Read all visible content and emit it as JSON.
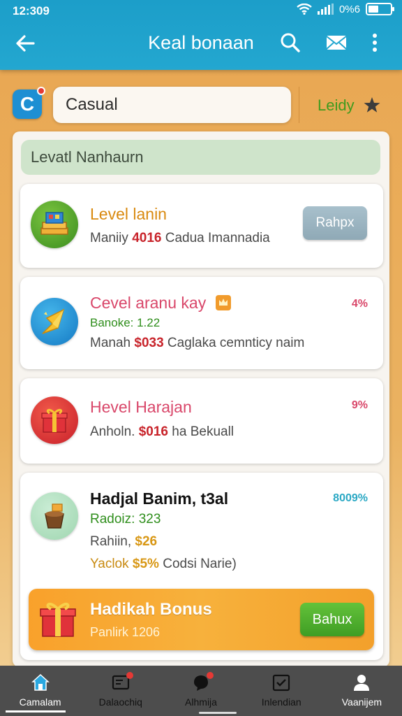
{
  "status": {
    "time": "12:309",
    "battery": "0%6",
    "battery_level": 0.45
  },
  "header": {
    "title": "Keal bonaan"
  },
  "search": {
    "value": "Casual",
    "filter_label": "Leidy"
  },
  "section": {
    "title": "Levatl Nanhaurn"
  },
  "cards": [
    {
      "title": "Level lanin",
      "line1_prefix": "Maniiy ",
      "line1_value": "4016",
      "line1_suffix": " Cadua Imannadia",
      "button": "Rahpx"
    },
    {
      "title": "Cevel aranu kay",
      "percent": "4%",
      "line0": "Banoke: 1.22",
      "line1_prefix": "Manah ",
      "line1_value": "$033",
      "line1_suffix": " Caglaka cemnticy naim"
    },
    {
      "title": "Hevel Harajan",
      "percent": "9%",
      "line1_prefix": "Anholn. ",
      "line1_value": "$016",
      "line1_suffix": " ha Bekuall"
    },
    {
      "title": "Hadjal Banim, t3al",
      "percent": "8009%",
      "line0": "Radoiz: 323",
      "line1_prefix": "Rahiin, ",
      "line1_value": "$26",
      "line2_prefix": "Yaclok ",
      "line2_value": "$5%",
      "line2_suffix": " Codsi Narie)"
    }
  ],
  "bonus": {
    "title": "Hadikah Bonus",
    "subtitle": "Panlirk 1206",
    "button": "Bahux"
  },
  "nav": [
    {
      "label": "Camalam",
      "icon": "home-icon"
    },
    {
      "label": "Dalaochiq",
      "icon": "message-icon"
    },
    {
      "label": "Alhmija",
      "icon": "chat-icon"
    },
    {
      "label": "Inlendian",
      "icon": "checklist-icon"
    },
    {
      "label": "Vaanijem",
      "icon": "profile-icon"
    }
  ],
  "colors": {
    "header": "#1c9ec9",
    "background": "#e9a651",
    "accent_green": "#3f9d24",
    "accent_red": "#c8232a",
    "accent_orange": "#f9a12b",
    "nav_bar": "#4d4d4d"
  }
}
